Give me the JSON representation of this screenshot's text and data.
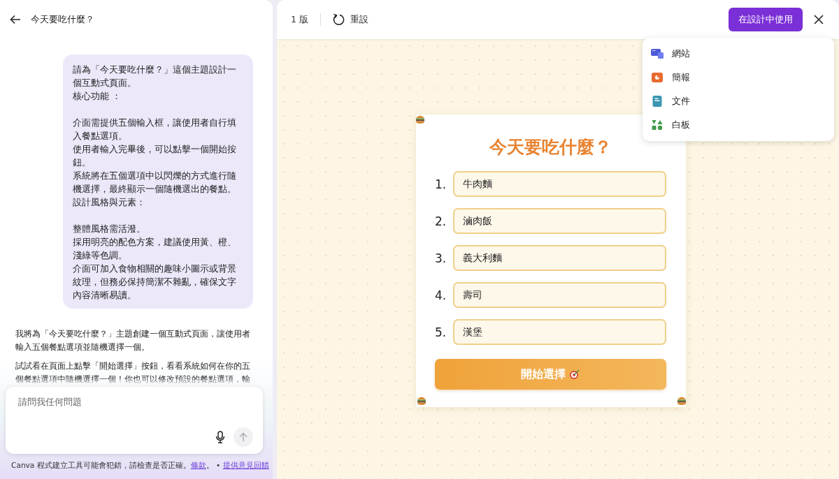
{
  "chat": {
    "title": "今天要吃什麼？",
    "user_message": [
      {
        "lines": [
          "請為「今天要吃什麼？」這個主題設計一個互動式頁面。",
          "核心功能 ："
        ]
      },
      {
        "lines": [
          "介面需提供五個輸入框，讓使用者自行填入餐點選項。",
          "使用者輸入完畢後，可以點擊一個開始按鈕。",
          "系統將在五個選項中以閃爍的方式進行隨機選擇，最終顯示一個隨機選出的餐點。",
          "設計風格與元素："
        ]
      },
      {
        "lines": [
          "整體風格需活潑。",
          "採用明亮的配色方案，建議使用黃、橙、淺綠等色調。",
          "介面可加入食物相關的趣味小圖示或背景紋理，但務必保持簡潔不雜亂，確保文字內容清晰易讀。"
        ]
      }
    ],
    "assistant_paragraphs": [
      "我將為「今天要吃什麼？」主題創建一個互動式頁面，讓使用者輸入五個餐點選項並隨機選擇一個。",
      "試試看在頁面上點擊「開始選擇」按鈕，看看系統如何在你的五個餐點選項中隨機選擇一個！你也可以修改預設的餐點選項，輸"
    ],
    "composer": {
      "placeholder": "請問我任何問題"
    },
    "footer": {
      "text": "Canva 程式建立工具可能會犯錯，請檢查是否正確。",
      "terms_link": "條款",
      "separator": "。 •",
      "feedback_link": "提供意見回饋"
    }
  },
  "preview": {
    "version": "1 版",
    "reset": "重設",
    "use_button": "在設計中使用",
    "menu": [
      {
        "label": "網站",
        "kind": "website"
      },
      {
        "label": "簡報",
        "kind": "presentation"
      },
      {
        "label": "文件",
        "kind": "document"
      },
      {
        "label": "白板",
        "kind": "whiteboard"
      }
    ],
    "app": {
      "title": "今天要吃什麼？",
      "options": [
        {
          "number": "1.",
          "value": "牛肉麵"
        },
        {
          "number": "2.",
          "value": "滷肉飯"
        },
        {
          "number": "3.",
          "value": "義大利麵"
        },
        {
          "number": "4.",
          "value": "壽司"
        },
        {
          "number": "5.",
          "value": "漢堡"
        }
      ],
      "start_button": "開始選擇"
    }
  }
}
